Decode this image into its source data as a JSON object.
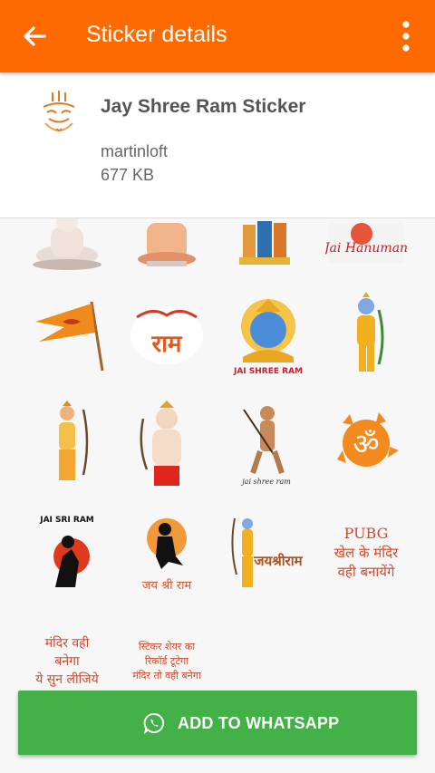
{
  "appbar": {
    "title": "Sticker details",
    "back_icon": "arrow-back-icon",
    "menu_icon": "more-vertical-icon",
    "color": "#ff6a00"
  },
  "pack": {
    "name": "Jay Shree Ram Sticker",
    "author": "martinloft",
    "size": "677 KB",
    "tray_icon": "deity-face-icon"
  },
  "stickers": {
    "s_jai_hanuman": "Jai Hanuman",
    "s_ram": "राम",
    "s_jai_shree_ram": "JAI SHREE RAM",
    "s_jai_shree_ram_small": "jai shree ram",
    "s_om": "ॐ",
    "s_jai_sri_ram": "JAI SRI RAM",
    "s_jay_shri_ram_hi": "जय श्री राम",
    "s_jayshri": "जयश्रीराम",
    "s_pubg": [
      "PUBG",
      "खेल के मंदिर",
      "वही बनायेंगे"
    ],
    "s_mandir": [
      "मंदिर वही",
      "बनेगा",
      "ये सुन लीजिये"
    ],
    "s_sticker_share": [
      "स्टिकर शेयर का",
      "रिकॉर्ड टूटेगा",
      "मंदिर तो वही बनेगा"
    ]
  },
  "action": {
    "label": "ADD TO WHATSAPP",
    "icon": "whatsapp-icon",
    "color": "#43b048"
  }
}
